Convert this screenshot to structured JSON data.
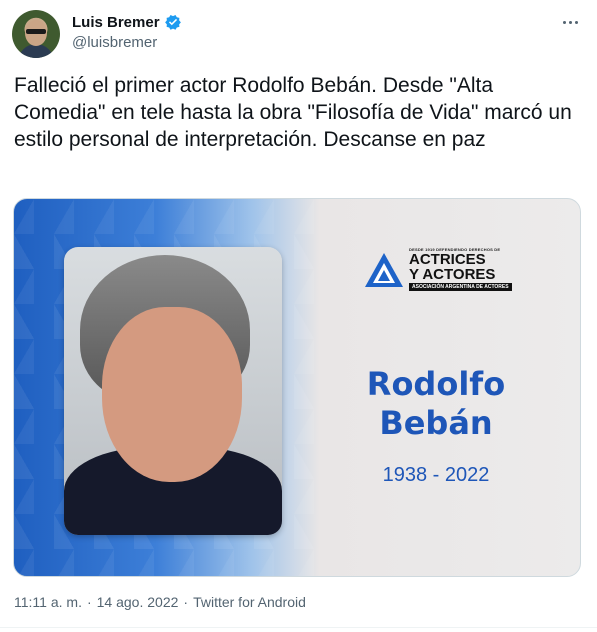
{
  "author": {
    "display_name": "Luis Bremer",
    "handle": "@luisbremer",
    "verified": true,
    "avatar_icon": "avatar"
  },
  "tweet": {
    "text": "Falleció el primer actor Rodolfo Bebán. Desde \"Alta Comedia\" en tele hasta la obra \"Filosofía de Vida\" marcó un estilo personal de interpretación. Descanse en paz"
  },
  "media": {
    "logo": {
      "tagline": "DESDE 1919 DEFENDIENDO DERECHOS DE",
      "line1": "ACTRICES",
      "line2": "Y ACTORES",
      "bar": "ASOCIACIÓN ARGENTINA DE ACTORES"
    },
    "name_line1": "Rodolfo",
    "name_line2": "Bebán",
    "years": "1938 - 2022",
    "colors": {
      "name": "#1e56b8",
      "blue_band": "#1f5fc0",
      "panel": "#ecebeb"
    }
  },
  "footer": {
    "time": "11:11 a. m.",
    "date": "14 ago. 2022",
    "source": "Twitter for Android",
    "separator": "·"
  },
  "menu": {
    "icon": "more-dots-icon"
  }
}
